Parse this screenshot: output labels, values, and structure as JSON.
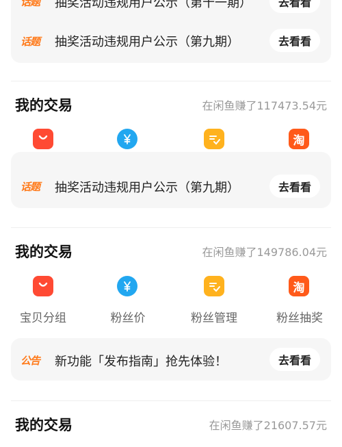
{
  "top_card": {
    "tag": "话题",
    "notice_partial": "抽奖活动违规用户公示（第十一期）",
    "button": "去看看"
  },
  "card_a": {
    "tag": "话题",
    "notice": "抽奖活动违规用户公示（第九期）",
    "button": "去看看"
  },
  "section1": {
    "title": "我的交易",
    "earned": "在闲鱼赚了117473.54元"
  },
  "card_b": {
    "tag": "话题",
    "notice": "抽奖活动违规用户公示（第九期）",
    "button": "去看看"
  },
  "section2": {
    "title": "我的交易",
    "earned": "在闲鱼赚了149786.04元",
    "items": [
      {
        "label": "宝贝分组",
        "icon": "bag-icon"
      },
      {
        "label": "粉丝价",
        "icon": "yuan-icon"
      },
      {
        "label": "粉丝管理",
        "icon": "checklist-icon"
      },
      {
        "label": "粉丝抽奖",
        "icon": "taobao-icon"
      }
    ]
  },
  "card_c": {
    "tag": "公告",
    "notice": "新功能「发布指南」抢先体验！",
    "button": "去看看"
  },
  "section3": {
    "title": "我的交易",
    "earned": "在闲鱼赚了21607.57元"
  },
  "colors": {
    "accent_orange": "#ff7a1a",
    "bag_red": "#ff4a33",
    "yuan_blue": "#22a7f0",
    "check_yellow": "#ffb21e",
    "taobao_orange": "#ff5a1a"
  },
  "icon_glyphs": {
    "taobao": "淘"
  }
}
